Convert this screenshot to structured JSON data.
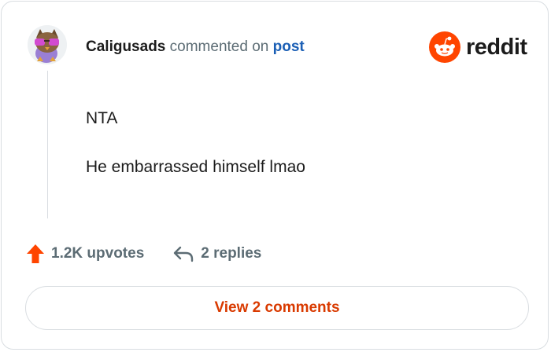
{
  "comment": {
    "author": "Caligusads",
    "action": "commented on",
    "target_link": "post",
    "lines": [
      "NTA",
      "He embarrassed himself lmao"
    ]
  },
  "brand": {
    "name": "reddit",
    "icon": "reddit-snoo-icon",
    "color": "#ff4500"
  },
  "stats": {
    "upvotes": "1.2K upvotes",
    "upvote_icon": "upvote-arrow-icon",
    "upvote_color": "#ff4500",
    "replies": "2 replies",
    "reply_icon": "reply-arrow-icon"
  },
  "cta": {
    "label": "View 2 comments",
    "color": "#d93a00"
  }
}
